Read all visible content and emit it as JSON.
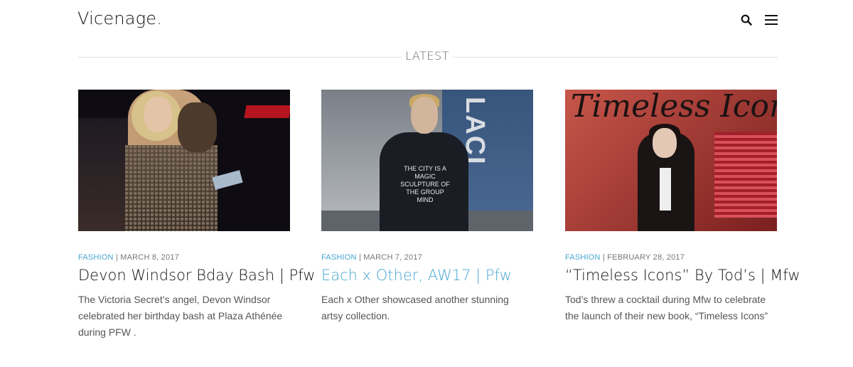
{
  "brand": {
    "logo": "Vicenage."
  },
  "header": {
    "search_icon": "search-icon",
    "menu_icon": "menu-icon"
  },
  "section": {
    "title": "LATEST"
  },
  "colors": {
    "accent": "#49a7d2",
    "text": "#111111",
    "muted": "#777777"
  },
  "posts": [
    {
      "category": "FASHION",
      "date": "| MARCH 8, 2017",
      "title": "Devon Windsor Bday Bash | Pfw",
      "excerpt": "The Victoria Secret’s angel, Devon Windsor celebrated her birthday bash at Plaza Athénée during PFW .",
      "active": false
    },
    {
      "category": "FASHION",
      "date": "| MARCH 7, 2017",
      "title": "Each x Other, AW17 | Pfw",
      "excerpt": "Each x Other showcased another stunning artsy collection.",
      "active": true,
      "image_text": "THE CITY IS A MAGIC SCULPTURE OF THE GROUP MIND",
      "image_letters": "LACI"
    },
    {
      "category": "FASHION",
      "date": "| FEBRUARY 28, 2017",
      "title": "“Timeless Icons” By Tod’s | Mfw",
      "excerpt": "Tod’s  threw a cocktail during Mfw to celebrate the launch of  their new book, “Timeless Icons”",
      "active": false,
      "image_text": "Timeless Icons"
    }
  ]
}
